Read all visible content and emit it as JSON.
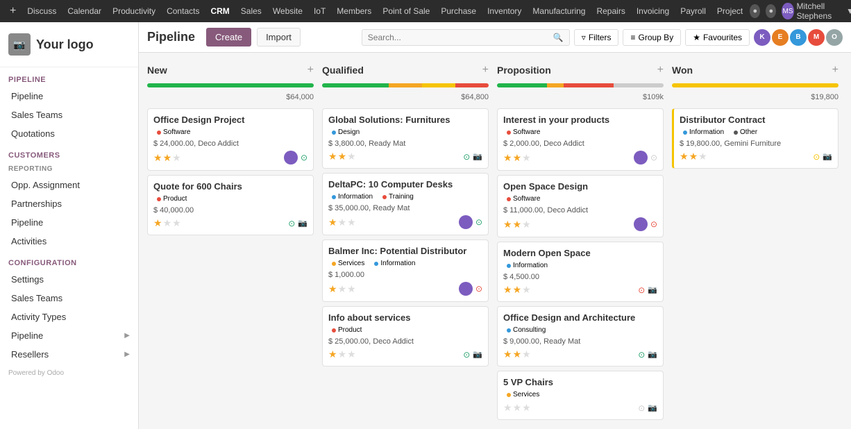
{
  "topnav": {
    "items": [
      {
        "label": "Discuss",
        "active": false
      },
      {
        "label": "Calendar",
        "active": false
      },
      {
        "label": "Productivity",
        "active": false
      },
      {
        "label": "Contacts",
        "active": false
      },
      {
        "label": "CRM",
        "active": true
      },
      {
        "label": "Sales",
        "active": false
      },
      {
        "label": "Website",
        "active": false
      },
      {
        "label": "IoT",
        "active": false
      },
      {
        "label": "Members",
        "active": false
      },
      {
        "label": "Point of Sale",
        "active": false
      },
      {
        "label": "Purchase",
        "active": false
      },
      {
        "label": "Inventory",
        "active": false
      },
      {
        "label": "Manufacturing",
        "active": false
      },
      {
        "label": "Repairs",
        "active": false
      },
      {
        "label": "Invoicing",
        "active": false
      },
      {
        "label": "Payroll",
        "active": false
      },
      {
        "label": "Project",
        "active": false
      }
    ],
    "user": "Mitchell Stephens",
    "user_initials": "MS"
  },
  "sidebar": {
    "logo": "Your logo",
    "sections": [
      {
        "label": "Pipeline",
        "items": [
          {
            "label": "Pipeline",
            "active": false
          },
          {
            "label": "Sales Teams",
            "active": false
          },
          {
            "label": "Quotations",
            "active": false
          }
        ]
      },
      {
        "label": "Customers",
        "subsections": [
          {
            "label": "Reporting",
            "items": [
              {
                "label": "Opp. Assignment",
                "active": false
              },
              {
                "label": "Partnerships",
                "active": false
              },
              {
                "label": "Pipeline",
                "active": false
              },
              {
                "label": "Activities",
                "active": false
              }
            ]
          }
        ]
      },
      {
        "label": "Configuration",
        "items": [
          {
            "label": "Settings",
            "active": false
          },
          {
            "label": "Sales Teams",
            "active": false
          },
          {
            "label": "Activity Types",
            "active": false
          },
          {
            "label": "Pipeline",
            "active": false,
            "arrow": true
          },
          {
            "label": "Resellers",
            "active": false,
            "arrow": true
          }
        ]
      }
    ],
    "footer": "Powered by Odoo"
  },
  "toolbar": {
    "title": "Pipeline",
    "create_label": "Create",
    "import_label": "Import",
    "search_placeholder": "Search...",
    "filters_label": "Filters",
    "groupby_label": "Group By",
    "favorites_label": "Favourites"
  },
  "view_avatars": [
    {
      "initials": "K",
      "color": "#7c5cbf"
    },
    {
      "initials": "E",
      "color": "#e67e22"
    },
    {
      "initials": "B",
      "color": "#3498db"
    },
    {
      "initials": "M",
      "color": "#e74c3c"
    },
    {
      "initials": "O",
      "color": "#95a5a6"
    }
  ],
  "columns": [
    {
      "title": "New",
      "amount": "$64,000",
      "progress": [
        {
          "color": "#21b44b",
          "width": 100
        }
      ],
      "cards": [
        {
          "title": "Office Design Project",
          "tags": [
            {
              "label": "Software",
              "color": "#e74c3c"
            }
          ],
          "amount": "$ 24,000.00, Deco Addict",
          "stars": 2,
          "status_icon": "green",
          "has_avatar": true
        },
        {
          "title": "Quote for 600 Chairs",
          "tags": [
            {
              "label": "Product",
              "color": "#e74c3c"
            }
          ],
          "amount": "$ 40,000.00",
          "stars": 1,
          "status_icon": "green",
          "has_avatar": false
        }
      ]
    },
    {
      "title": "Qualified",
      "amount": "$64,800",
      "progress": [
        {
          "color": "#21b44b",
          "width": 40
        },
        {
          "color": "#f5a623",
          "width": 20
        },
        {
          "color": "#f5c400",
          "width": 20
        },
        {
          "color": "#e74c3c",
          "width": 20
        }
      ],
      "cards": [
        {
          "title": "Global Solutions: Furnitures",
          "tags": [
            {
              "label": "Design",
              "color": "#3498db"
            }
          ],
          "amount": "$ 3,800.00, Ready Mat",
          "stars": 2,
          "status_icon": "green",
          "has_avatar": false
        },
        {
          "title": "DeltaPC: 10 Computer Desks",
          "tags": [
            {
              "label": "Information",
              "color": "#3498db"
            },
            {
              "label": "Training",
              "color": "#e74c3c"
            }
          ],
          "amount": "$ 35,000.00, Ready Mat",
          "stars": 1,
          "status_icon": "green",
          "has_avatar": true
        },
        {
          "title": "Balmer Inc: Potential Distributor",
          "tags": [
            {
              "label": "Services",
              "color": "#f5a623"
            },
            {
              "label": "Information",
              "color": "#3498db"
            }
          ],
          "amount": "$ 1,000.00",
          "stars": 1,
          "status_icon": "red",
          "has_avatar": true
        },
        {
          "title": "Info about services",
          "tags": [
            {
              "label": "Product",
              "color": "#e74c3c"
            }
          ],
          "amount": "$ 25,000.00, Deco Addict",
          "stars": 1,
          "status_icon": "green",
          "has_avatar": false
        }
      ]
    },
    {
      "title": "Proposition",
      "amount": "$109k",
      "progress": [
        {
          "color": "#21b44b",
          "width": 30
        },
        {
          "color": "#f5a623",
          "width": 10
        },
        {
          "color": "#e74c3c",
          "width": 30
        },
        {
          "color": "#ccc",
          "width": 30
        }
      ],
      "cards": [
        {
          "title": "Interest in your products",
          "tags": [
            {
              "label": "Software",
              "color": "#e74c3c"
            }
          ],
          "amount": "$ 2,000.00, Deco Addict",
          "stars": 2,
          "status_icon": "gray",
          "has_avatar": true
        },
        {
          "title": "Open Space Design",
          "tags": [
            {
              "label": "Software",
              "color": "#e74c3c"
            }
          ],
          "amount": "$ 11,000.00, Deco Addict",
          "stars": 2,
          "status_icon": "orange",
          "has_avatar": true
        },
        {
          "title": "Modern Open Space",
          "tags": [
            {
              "label": "Information",
              "color": "#3498db"
            }
          ],
          "amount": "$ 4,500.00",
          "stars": 2,
          "status_icon": "orange",
          "has_avatar": false
        },
        {
          "title": "Office Design and Architecture",
          "tags": [
            {
              "label": "Consulting",
              "color": "#3498db"
            }
          ],
          "amount": "$ 9,000.00, Ready Mat",
          "stars": 2,
          "status_icon": "green",
          "has_avatar": false
        },
        {
          "title": "5 VP Chairs",
          "tags": [
            {
              "label": "Services",
              "color": "#f5a623"
            }
          ],
          "amount": "",
          "stars": 0,
          "status_icon": "gray",
          "has_avatar": false
        }
      ]
    },
    {
      "title": "Won",
      "amount": "$19,800",
      "is_won": true,
      "progress": [
        {
          "color": "#f5c400",
          "width": 100
        }
      ],
      "cards": [
        {
          "title": "Distributor Contract",
          "tags": [
            {
              "label": "Information",
              "color": "#3498db"
            },
            {
              "label": "Other",
              "color": "#555"
            }
          ],
          "amount": "$ 19,800.00, Gemini Furniture",
          "stars": 2,
          "status_icon": "yellow",
          "has_avatar": false
        }
      ]
    }
  ]
}
